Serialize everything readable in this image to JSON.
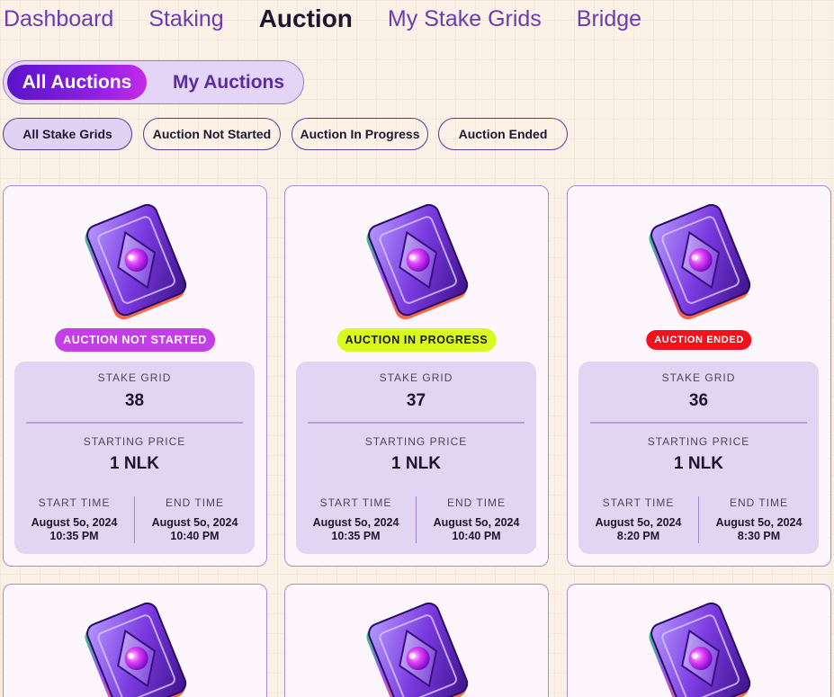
{
  "nav": {
    "items": [
      {
        "label": "Dashboard"
      },
      {
        "label": "Staking"
      },
      {
        "label": "Auction"
      },
      {
        "label": "My Stake Grids"
      },
      {
        "label": "Bridge"
      }
    ],
    "active": "Auction"
  },
  "tabs": {
    "all": "All Auctions",
    "mine": "My Auctions",
    "active": "All Auctions"
  },
  "filters": [
    {
      "label": "All Stake Grids"
    },
    {
      "label": "Auction Not Started"
    },
    {
      "label": "Auction In Progress"
    },
    {
      "label": "Auction Ended"
    }
  ],
  "card_labels": {
    "stake_grid": "STAKE GRID",
    "starting_price": "STARTING PRICE",
    "start_time": "START TIME",
    "end_time": "END TIME"
  },
  "cards": [
    {
      "status": "AUCTION NOT STARTED",
      "grid": "38",
      "price": "1 NLK",
      "start_date": "August 5o, 2024",
      "start_time": "10:35 PM",
      "end_date": "August 5o, 2024",
      "end_time": "10:40 PM"
    },
    {
      "status": "AUCTION IN PROGRESS",
      "grid": "37",
      "price": "1 NLK",
      "start_date": "August 5o, 2024",
      "start_time": "10:35 PM",
      "end_date": "August 5o, 2024",
      "end_time": "10:40 PM"
    },
    {
      "status": "AUCTION ENDED",
      "grid": "36",
      "price": "1 NLK",
      "start_date": "August 5o, 2024",
      "start_time": "8:20 PM",
      "end_date": "August 5o, 2024",
      "end_time": "8:30 PM"
    }
  ],
  "colors": {
    "accent": "#7a1fe0",
    "status_not_started": "#c43ee8",
    "status_in_progress": "#d8fa1e",
    "status_ended": "#f2111c",
    "background": "#fcf1e6"
  },
  "icons": {
    "card_image": "stake-grid-gem-icon"
  }
}
